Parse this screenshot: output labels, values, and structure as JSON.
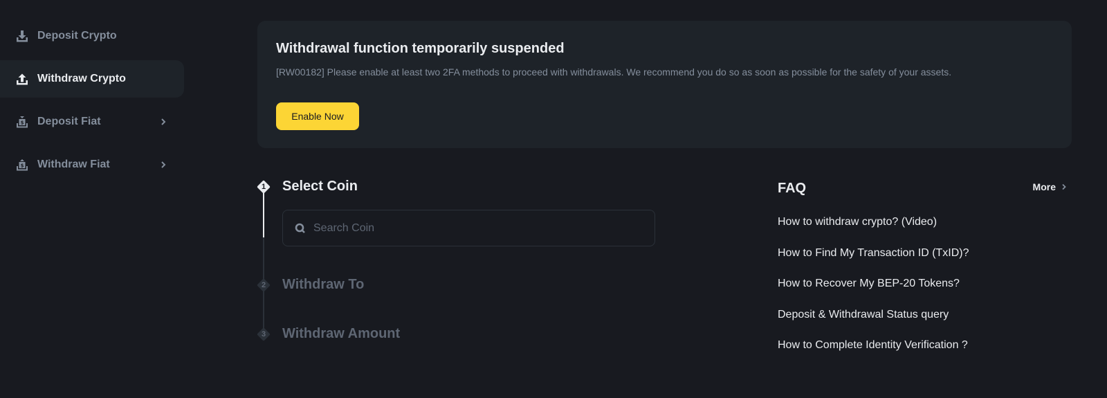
{
  "sidebar": {
    "items": [
      {
        "label": "Deposit Crypto",
        "icon": "download-icon",
        "active": false,
        "has_submenu": false
      },
      {
        "label": "Withdraw Crypto",
        "icon": "upload-icon",
        "active": true,
        "has_submenu": false
      },
      {
        "label": "Deposit Fiat",
        "icon": "deposit-fiat-icon",
        "active": false,
        "has_submenu": true
      },
      {
        "label": "Withdraw Fiat",
        "icon": "withdraw-fiat-icon",
        "active": false,
        "has_submenu": true
      }
    ]
  },
  "banner": {
    "title": "Withdrawal function temporarily suspended",
    "description": "[RW00182] Please enable at least two 2FA methods to proceed with withdrawals. We recommend you do so as soon as possible for the safety of your assets.",
    "button_label": "Enable Now"
  },
  "steps": [
    {
      "number": "1",
      "title": "Select Coin",
      "active": true
    },
    {
      "number": "2",
      "title": "Withdraw To",
      "active": false
    },
    {
      "number": "3",
      "title": "Withdraw Amount",
      "active": false
    }
  ],
  "search": {
    "placeholder": "Search Coin",
    "value": ""
  },
  "faq": {
    "title": "FAQ",
    "more_label": "More",
    "items": [
      "How to withdraw crypto? (Video)",
      "How to Find My Transaction ID (TxID)?",
      "How to Recover My BEP-20 Tokens?",
      "Deposit & Withdrawal Status query",
      "How to Complete Identity Verification ?"
    ]
  },
  "colors": {
    "background": "#181a20",
    "panel": "#1e2329",
    "accent": "#fcd535",
    "text_primary": "#eaecef",
    "text_secondary": "#848e9c",
    "text_disabled": "#5e6673"
  }
}
